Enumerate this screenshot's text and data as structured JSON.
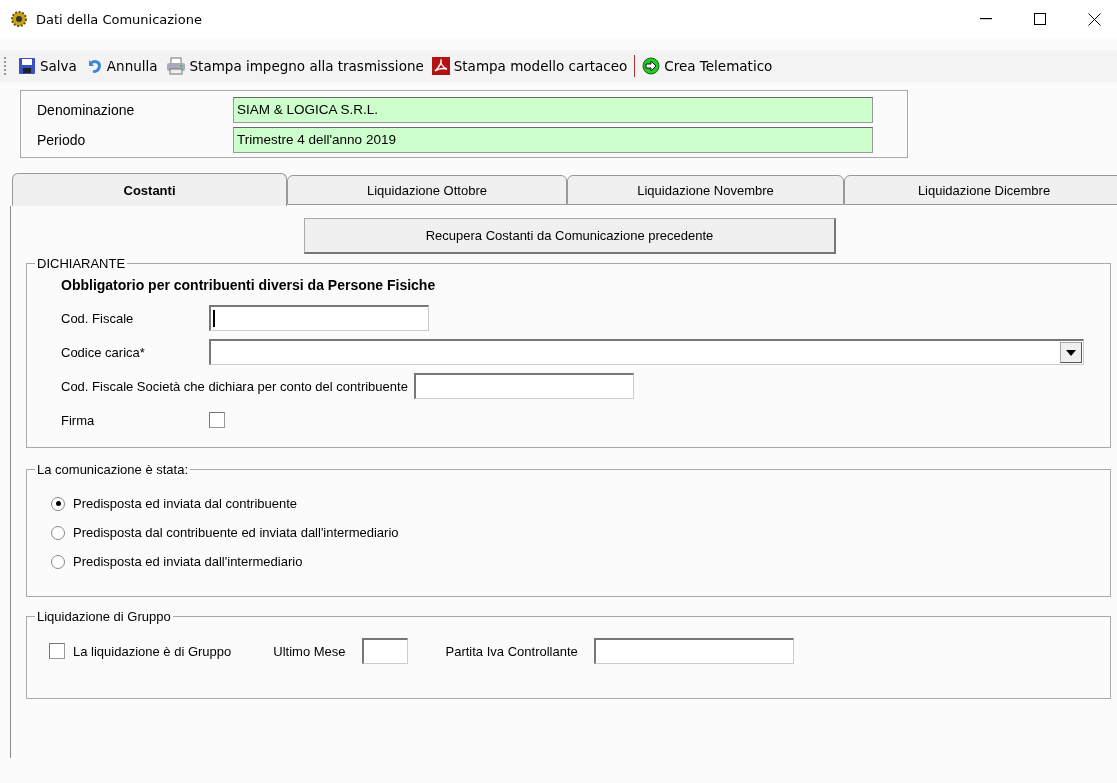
{
  "window": {
    "title": "Dati della Comunicazione"
  },
  "toolbar": [
    {
      "kind": "save",
      "label": "Salva"
    },
    {
      "kind": "undo",
      "label": "Annulla"
    },
    {
      "kind": "print",
      "label": "Stampa impegno alla trasmissione"
    },
    {
      "kind": "pdf",
      "label": "Stampa modello cartaceo"
    },
    {
      "kind": "separator"
    },
    {
      "kind": "telematic",
      "label": "Crea Telematico"
    }
  ],
  "header": [
    {
      "label": "Denominazione",
      "value": "SIAM & LOGICA S.R.L."
    },
    {
      "label": "Periodo",
      "value": "Trimestre 4 dell'anno 2019"
    }
  ],
  "tabs": [
    {
      "label": "Costanti",
      "selected": true
    },
    {
      "label": "Liquidazione Ottobre",
      "selected": false
    },
    {
      "label": "Liquidazione Novembre",
      "selected": false
    },
    {
      "label": "Liquidazione Dicembre",
      "selected": false
    }
  ],
  "recover_button": "Recupera Costanti da Comunicazione precedente",
  "dichiarante": {
    "title": "DICHIARANTE",
    "note": "Obbligatorio per contribuenti diversi da Persone Fisiche",
    "fields": [
      {
        "kind": "text",
        "label": "Cod. Fiscale",
        "focused": true
      },
      {
        "kind": "select",
        "label": "Codice carica*"
      },
      {
        "kind": "inline_text",
        "label": "Cod. Fiscale Società che dichiara per conto del contribuente"
      },
      {
        "kind": "checkbox",
        "label": "Firma",
        "checked": false
      }
    ]
  },
  "comunicazione": {
    "title": "La comunicazione è stata:",
    "options": [
      {
        "label": "Predisposta ed inviata dal contribuente",
        "selected": true
      },
      {
        "label": "Predisposta dal contribuente ed inviata dall'intermediario",
        "selected": false
      },
      {
        "label": "Predisposta ed inviata dall'intermediario",
        "selected": false
      }
    ]
  },
  "gruppo": {
    "title": "Liquidazione di Gruppo",
    "checkbox": {
      "label": "La liquidazione è di Gruppo",
      "checked": false
    },
    "month_label": "Ultimo Mese",
    "vat_label": "Partita Iva Controllante"
  }
}
